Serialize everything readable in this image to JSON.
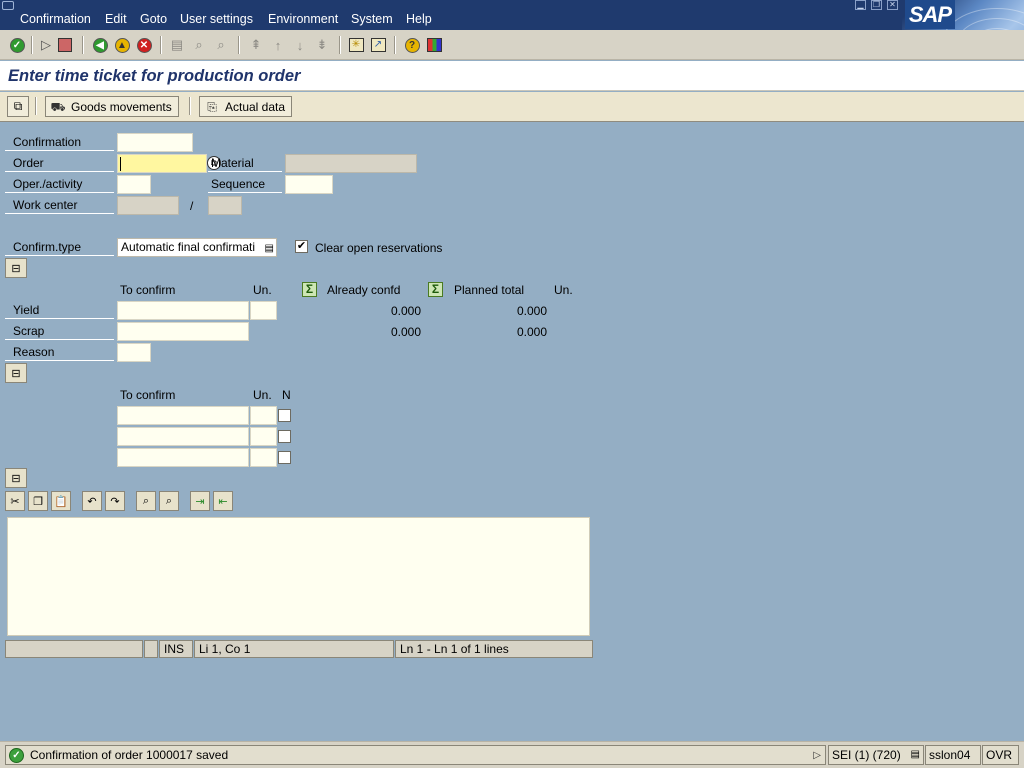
{
  "menubar": {
    "items": [
      "Confirmation",
      "Edit",
      "Goto",
      "User settings",
      "Environment",
      "System",
      "Help"
    ],
    "logo_text": "SAP"
  },
  "window": {
    "title": "Enter time ticket for production order"
  },
  "app_toolbar": {
    "goods_movements": "Goods movements",
    "actual_data": "Actual data"
  },
  "form": {
    "confirmation_label": "Confirmation",
    "confirmation_value": "",
    "order_label": "Order",
    "order_value": "",
    "material_label": "Material",
    "material_value": "",
    "operation_label": "Oper./activity",
    "operation_value": "",
    "sequence_label": "Sequence",
    "sequence_value": "",
    "work_center_label": "Work center",
    "work_center_value": "",
    "work_center_sep": "/",
    "work_center_plant_value": "",
    "confirm_type_label": "Confirm.type",
    "confirm_type_value": "Automatic final confirmati",
    "clear_reservations_label": "Clear open reservations",
    "clear_reservations_checked": true
  },
  "quantities": {
    "to_confirm_header": "To confirm",
    "unit_header": "Un.",
    "already_confd_header": "Already confd",
    "planned_total_header": "Planned total",
    "unit_header_2": "Un.",
    "rows": [
      {
        "label": "Yield",
        "to_confirm": "",
        "unit": "",
        "already_confd": "0.000",
        "planned_total": "0.000"
      },
      {
        "label": "Scrap",
        "to_confirm": "",
        "already_confd": "0.000",
        "planned_total": "0.000"
      }
    ],
    "reason_label": "Reason",
    "reason_value": ""
  },
  "activities": {
    "to_confirm_header": "To confirm",
    "unit_header": "Un.",
    "n_header": "N",
    "rows": [
      {
        "to_confirm": "",
        "unit": "",
        "no_remaining": false
      },
      {
        "to_confirm": "",
        "unit": "",
        "no_remaining": false
      },
      {
        "to_confirm": "",
        "unit": "",
        "no_remaining": false
      }
    ]
  },
  "editor": {
    "text": "",
    "mode": "INS",
    "cursor": "Li 1, Co 1",
    "lines": "Ln 1 - Ln 1 of 1 lines"
  },
  "statusbar": {
    "message": "Confirmation of order 1000017 saved",
    "session": "SEI (1) (720)",
    "server": "sslon04",
    "mode": "OVR"
  }
}
